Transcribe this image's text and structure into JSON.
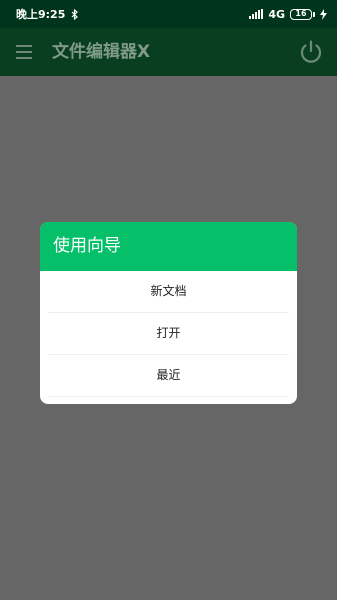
{
  "status_bar": {
    "time": "晚上9:25",
    "network": "4G",
    "battery": "16"
  },
  "toolbar": {
    "title": "文件编辑器X"
  },
  "dialog": {
    "title": "使用向导",
    "items": [
      {
        "label": "新文档"
      },
      {
        "label": "打开"
      },
      {
        "label": "最近"
      }
    ]
  },
  "colors": {
    "status_bar_bg": "#00351b",
    "toolbar_bg": "#0a3e21",
    "dialog_header": "#05c068",
    "scrim": "#666666"
  },
  "icons": {
    "menu": "hamburger-menu-icon",
    "power": "power-icon",
    "bluetooth": "bluetooth-icon",
    "signal": "signal-icon",
    "battery": "battery-icon",
    "charging": "lightning-icon"
  }
}
